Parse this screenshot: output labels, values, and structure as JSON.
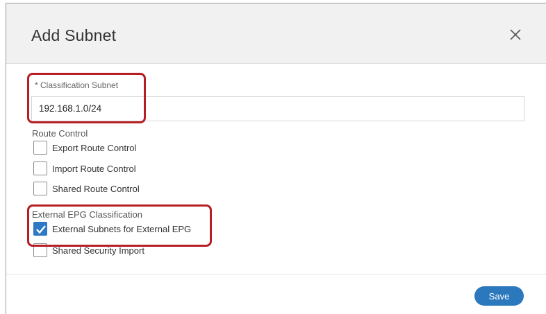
{
  "dialog": {
    "title": "Add Subnet",
    "close_icon": "close-icon"
  },
  "subnet": {
    "label": "* Classification Subnet",
    "value": "192.168.1.0/24"
  },
  "route_control": {
    "heading": "Route Control",
    "options": [
      {
        "label": "Export Route Control",
        "checked": false
      },
      {
        "label": "Import Route Control",
        "checked": false
      },
      {
        "label": "Shared Route Control",
        "checked": false
      }
    ]
  },
  "epg": {
    "heading": "External EPG Classification",
    "options": [
      {
        "label": "External Subnets for External EPG",
        "checked": true
      },
      {
        "label": "Shared Security Import",
        "checked": false
      }
    ]
  },
  "footer": {
    "save_label": "Save"
  },
  "colors": {
    "accent": "#2b78bd",
    "highlight": "#b51f24"
  }
}
